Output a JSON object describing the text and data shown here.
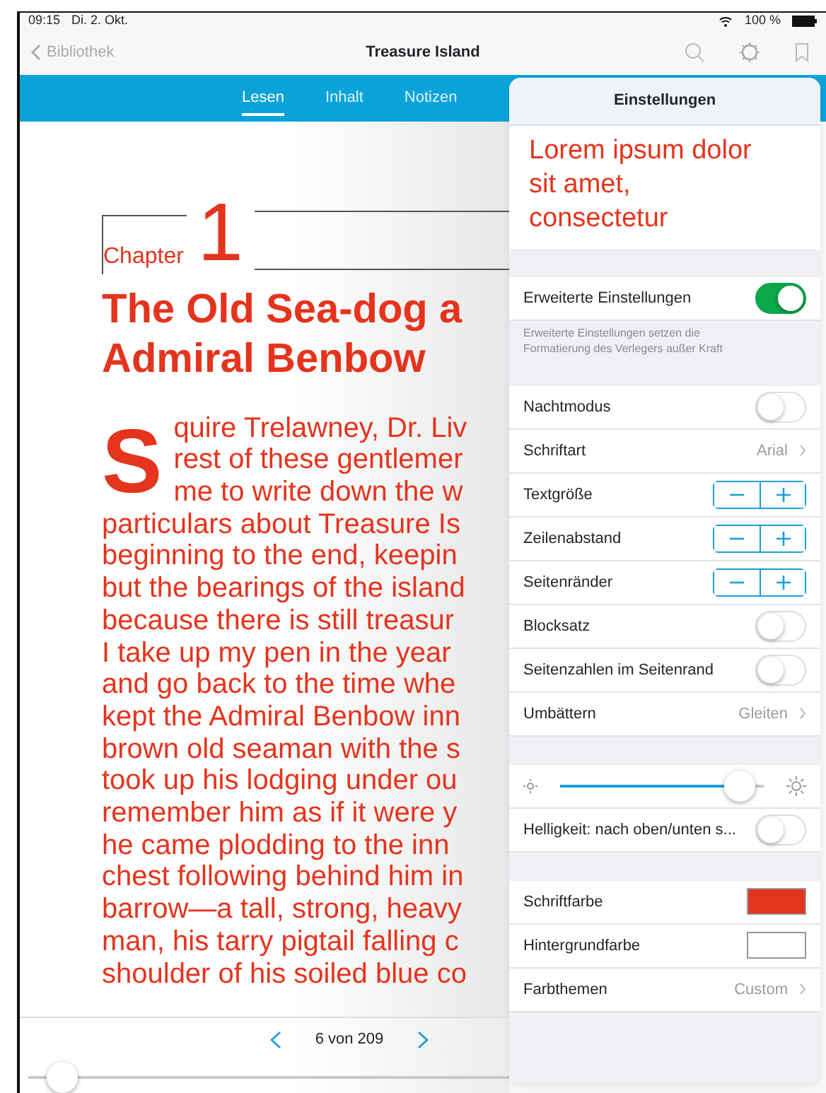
{
  "status_bar": {
    "time": "09:15",
    "date": "Di. 2. Okt.",
    "battery": "100 %"
  },
  "nav": {
    "back": "Bibliothek",
    "title": "Treasure Island"
  },
  "tabs": [
    {
      "label": "Lesen",
      "selected": true
    },
    {
      "label": "Inhalt",
      "selected": false
    },
    {
      "label": "Notizen",
      "selected": false
    }
  ],
  "book": {
    "chapter_label": "Chapter",
    "chapter_number": "1",
    "title_lines": [
      "The Old Sea-dog a",
      "Admiral Benbow"
    ],
    "drop_cap": "S",
    "lines": [
      "quire Trelawney, Dr. Liv",
      "rest of these gentlemer",
      "me to write down the w",
      "particulars about Treasure Is",
      "beginning to the end, keepin",
      "but the bearings of the island",
      "because there is still treasur",
      "I take up my pen in the year",
      "and go back to the time whe",
      "kept the Admiral Benbow inn",
      "brown old seaman with the s",
      "took up his lodging under ou",
      "remember him as if it were y",
      "he came plodding to the inn",
      "chest following behind him in",
      "barrow—a tall, strong, heavy",
      "man, his tarry pigtail falling c",
      "shoulder of his soiled blue co"
    ]
  },
  "pager": {
    "position": "6 von 209",
    "level": 0.04
  },
  "settings": {
    "title": "Einstellungen",
    "preview": "Lorem ipsum dolor sit amet, consectetur",
    "sections": [
      {
        "rows": [
          {
            "kind": "toggle",
            "label": "Erweiterte Einstellungen",
            "on": true
          }
        ],
        "footnote": "Erweiterte Einstellungen setzen die Formatierung des Verlegers außer Kraft"
      },
      {
        "rows": [
          {
            "kind": "toggle",
            "label": "Nachtmodus",
            "on": false
          },
          {
            "kind": "value",
            "label": "Schriftart",
            "value": "Arial"
          },
          {
            "kind": "stepper",
            "label": "Textgröße"
          },
          {
            "kind": "stepper",
            "label": "Zeilenabstand"
          },
          {
            "kind": "stepper",
            "label": "Seitenränder"
          },
          {
            "kind": "toggle",
            "label": "Blocksatz",
            "on": false
          },
          {
            "kind": "toggle",
            "label": "Seitenzahlen im Seitenrand",
            "on": false
          },
          {
            "kind": "value",
            "label": "Umbättern",
            "value": "Gleiten"
          }
        ]
      },
      {
        "rows": [
          {
            "kind": "slider",
            "level": 0.88
          },
          {
            "kind": "toggle",
            "label": "Helligkeit: nach oben/unten s...",
            "on": false
          }
        ]
      },
      {
        "rows": [
          {
            "kind": "color",
            "label": "Schriftfarbe",
            "color": "#e5341d"
          },
          {
            "kind": "color",
            "label": "Hintergrundfarbe",
            "color": "#ffffff"
          },
          {
            "kind": "value",
            "label": "Farbthemen",
            "value": "Custom"
          }
        ]
      }
    ]
  }
}
